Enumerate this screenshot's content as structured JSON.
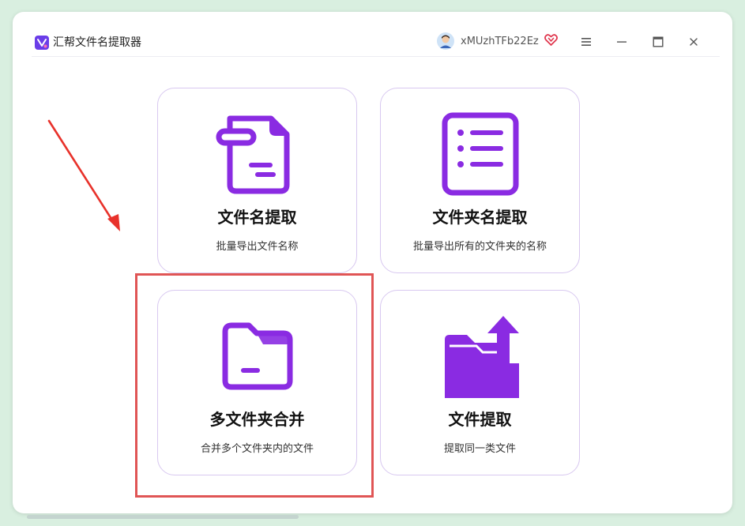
{
  "app": {
    "title": "汇帮文件名提取器",
    "username": "xMUzhTFb22Ez"
  },
  "cards": [
    {
      "title": "文件名提取",
      "desc": "批量导出文件名称",
      "icon": "file-name-icon"
    },
    {
      "title": "文件夹名提取",
      "desc": "批量导出所有的文件夹的名称",
      "icon": "list-icon"
    },
    {
      "title": "多文件夹合并",
      "desc": "合并多个文件夹内的文件",
      "icon": "folder-icon"
    },
    {
      "title": "文件提取",
      "desc": "提取同一类文件",
      "icon": "folder-upload-icon"
    }
  ],
  "colors": {
    "accent": "#8a2be2",
    "card_border": "#d8c8f0",
    "annotation": "#e05555",
    "background": "#d9efe0"
  }
}
